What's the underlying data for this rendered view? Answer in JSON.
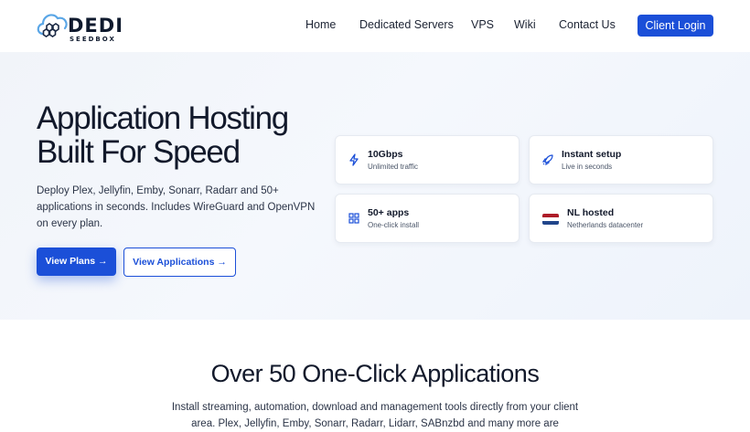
{
  "header": {
    "logo": {
      "text": "DEDI",
      "subtext": "SEEDBOX"
    },
    "nav": [
      "Home",
      "Dedicated Servers",
      "VPS",
      "Wiki",
      "Contact Us"
    ],
    "login_label": "Client Login"
  },
  "hero": {
    "title_line1": "Application Hosting",
    "title_line2": "Built For Speed",
    "description": "Deploy Plex, Jellyfin, Emby, Sonarr, Radarr and 50+ applications in seconds. Includes WireGuard and OpenVPN on every plan.",
    "primary_button": "View Plans →",
    "secondary_button": "View Applications →",
    "features": [
      {
        "icon": "lightning-icon",
        "title": "10Gbps",
        "subtitle": "Unlimited traffic"
      },
      {
        "icon": "rocket-icon",
        "title": "Instant setup",
        "subtitle": "Live in seconds"
      },
      {
        "icon": "grid-icon",
        "title": "50+ apps",
        "subtitle": "One-click install"
      },
      {
        "icon": "netherlands-flag-icon",
        "title": "NL hosted",
        "subtitle": "Netherlands datacenter"
      }
    ]
  },
  "apps_section": {
    "title": "Over 50 One-Click Applications",
    "description": "Install streaming, automation, download and management tools directly from your client area. Plex, Jellyfin, Emby, Sonarr, Radarr, Lidarr, SABnzbd and many more are"
  },
  "colors": {
    "accent": "#1b4fd8",
    "flag_red": "#ae1c28",
    "flag_white": "#ffffff",
    "flag_blue": "#21468b"
  }
}
